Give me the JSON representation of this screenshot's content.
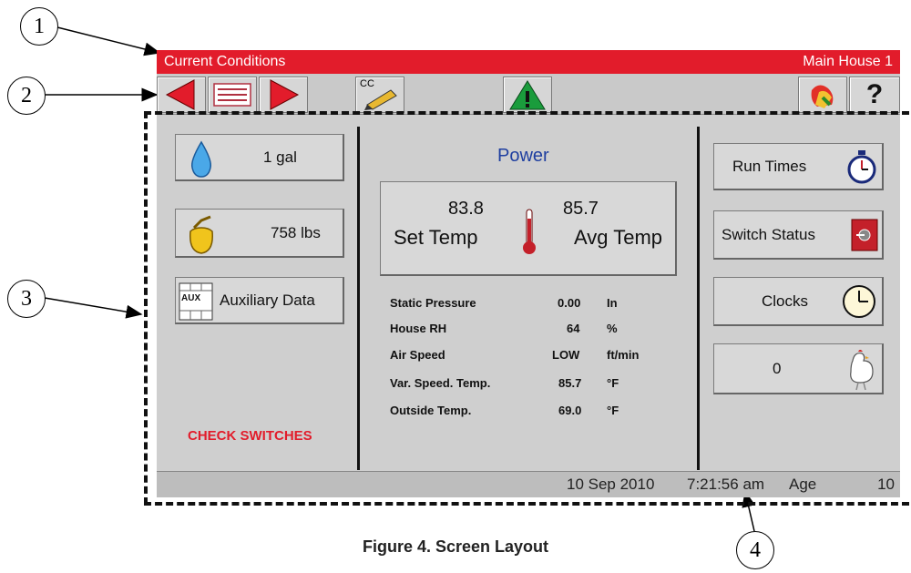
{
  "callouts": [
    "1",
    "2",
    "3",
    "4"
  ],
  "title_bar": {
    "left": "Current Conditions",
    "right": "Main House 1"
  },
  "toolbar": {
    "back_icon": "left-arrow-icon",
    "menu_icon": "menu-list-icon",
    "forward_icon": "right-arrow-icon",
    "cc_label": "CC",
    "warning_icon": "warning-icon",
    "chicken_icon": "hen-icon",
    "help_label": "?"
  },
  "left_panel": {
    "water_label": "1 gal",
    "feed_label": "758 lbs",
    "aux_label": "Auxiliary Data",
    "aux_icon_text": "AUX",
    "alarm_text": "CHECK SWITCHES"
  },
  "center_panel": {
    "power_label": "Power",
    "set_temp_value": "83.8",
    "set_temp_label": "Set Temp",
    "avg_temp_value": "85.7",
    "avg_temp_label": "Avg Temp",
    "readings": [
      {
        "name": "Static Pressure",
        "value": "0.00",
        "unit": "In"
      },
      {
        "name": "House RH",
        "value": "64",
        "unit": "%"
      },
      {
        "name": "Air Speed",
        "value": "LOW",
        "unit": "ft/min"
      },
      {
        "name": "Var. Speed. Temp.",
        "value": "85.7",
        "unit": "°F"
      },
      {
        "name": "Outside Temp.",
        "value": "69.0",
        "unit": "°F"
      }
    ]
  },
  "right_panel": {
    "run_times_label": "Run Times",
    "switch_status_label": "Switch Status",
    "clocks_label": "Clocks",
    "bird_count": "0"
  },
  "status_bar": {
    "date": "10 Sep 2010",
    "time": "7:21:56 am",
    "age_label": "Age",
    "age_value": "10"
  },
  "caption": "Figure 4. Screen Layout",
  "colors": {
    "title_bar": "#e21c2b",
    "arrow": "#e21c2b",
    "power": "#1f3fa0",
    "alarm": "#e21c2b",
    "warning": "#1a9c3c"
  }
}
